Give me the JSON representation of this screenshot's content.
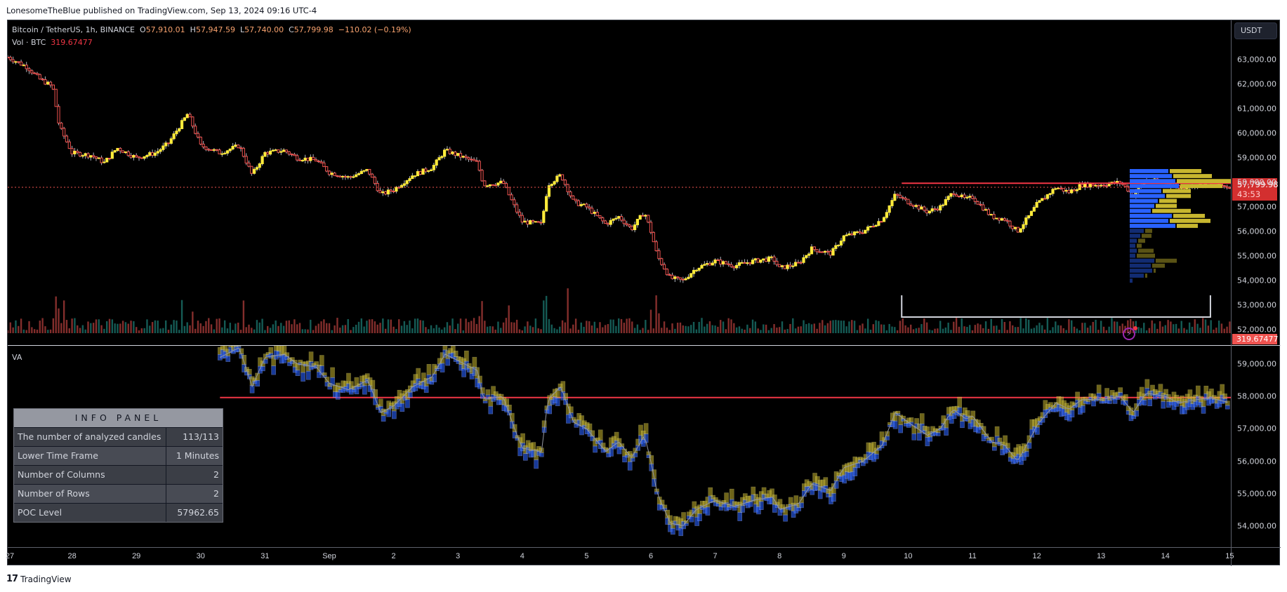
{
  "published": "LonesomeTheBlue published on TradingView.com, Sep 13, 2024 09:16 UTC-4",
  "legend": {
    "symbol": "Bitcoin / TetherUS, 1h, BINANCE",
    "o_label": "O",
    "o": "57,910.01",
    "h_label": "H",
    "h": "57,947.59",
    "l_label": "L",
    "l": "57,740.00",
    "c_label": "C",
    "c": "57,799.98",
    "change": "−110.02 (−0.19%)",
    "vol_label": "Vol · BTC",
    "vol": "319.67477"
  },
  "currency_button": "USDT",
  "last_price_tag": "57,799.98",
  "countdown": "43:53",
  "volume_tag": "319.67477",
  "lower_pane_label": "VA",
  "info_panel": {
    "title": "INFO PANEL",
    "rows": [
      {
        "label": "The number of analyzed candles",
        "value": "113/113"
      },
      {
        "label": "Lower Time Frame",
        "value": "1 Minutes"
      },
      {
        "label": "Number of Columns",
        "value": "2"
      },
      {
        "label": "Number of Rows",
        "value": "2"
      },
      {
        "label": "POC Level",
        "value": "57962.65"
      }
    ]
  },
  "footer": {
    "logo": "17",
    "brand": "TradingView"
  },
  "colors": {
    "up": "#ffeb3b",
    "down": "#ef5350",
    "vol_up": "#26a69a",
    "vol_down": "#ef5350",
    "poc_line": "#f23645",
    "profile_buy": "#2962ff",
    "profile_sell": "#c8b72f",
    "range_box": "#d1d4dc"
  },
  "chart_data": [
    {
      "type": "candlestick",
      "title": "Bitcoin / TetherUS, 1h, BINANCE",
      "yaxis_ticks": [
        "63,000.00",
        "62,000.00",
        "61,000.00",
        "60,000.00",
        "59,000.00",
        "58,000.00",
        "57,000.00",
        "56,000.00",
        "55,000.00",
        "54,000.00",
        "53,000.00",
        "52,000.00"
      ],
      "ylim": [
        51500,
        63300
      ],
      "xaxis_ticks": [
        "27",
        "28",
        "29",
        "30",
        "31",
        "Sep",
        "2",
        "3",
        "4",
        "5",
        "6",
        "7",
        "8",
        "9",
        "10",
        "11",
        "12",
        "13",
        "14",
        "15"
      ],
      "last_close": 57799.98,
      "poc_level": 57962.65,
      "price_path": [
        [
          27.0,
          63100
        ],
        [
          27.3,
          62700
        ],
        [
          27.5,
          62200
        ],
        [
          27.7,
          61900
        ],
        [
          27.8,
          60300
        ],
        [
          28.0,
          59200
        ],
        [
          28.3,
          59100
        ],
        [
          28.5,
          58800
        ],
        [
          28.7,
          59400
        ],
        [
          29.0,
          59000
        ],
        [
          29.3,
          59200
        ],
        [
          29.5,
          59600
        ],
        [
          29.8,
          60800
        ],
        [
          30.0,
          59500
        ],
        [
          30.3,
          59200
        ],
        [
          30.6,
          59500
        ],
        [
          30.8,
          58300
        ],
        [
          31.0,
          59200
        ],
        [
          31.3,
          59300
        ],
        [
          31.5,
          59000
        ],
        [
          31.8,
          58900
        ],
        [
          32.0,
          58400
        ],
        [
          32.3,
          58200
        ],
        [
          32.6,
          58500
        ],
        [
          32.8,
          57500
        ],
        [
          33.0,
          57700
        ],
        [
          33.3,
          58300
        ],
        [
          33.6,
          58600
        ],
        [
          33.8,
          59300
        ],
        [
          34.0,
          59100
        ],
        [
          34.3,
          58800
        ],
        [
          34.4,
          57900
        ],
        [
          34.7,
          58000
        ],
        [
          34.9,
          56900
        ],
        [
          35.0,
          56400
        ],
        [
          35.3,
          56300
        ],
        [
          35.4,
          57900
        ],
        [
          35.6,
          58300
        ],
        [
          35.8,
          57200
        ],
        [
          36.0,
          57000
        ],
        [
          36.3,
          56300
        ],
        [
          36.5,
          56600
        ],
        [
          36.7,
          56100
        ],
        [
          36.9,
          56800
        ],
        [
          37.0,
          56000
        ],
        [
          37.1,
          55000
        ],
        [
          37.3,
          54100
        ],
        [
          37.5,
          54000
        ],
        [
          37.7,
          54500
        ],
        [
          38.0,
          54800
        ],
        [
          38.3,
          54600
        ],
        [
          38.6,
          54800
        ],
        [
          38.9,
          54900
        ],
        [
          39.0,
          54500
        ],
        [
          39.3,
          54700
        ],
        [
          39.5,
          55300
        ],
        [
          39.8,
          55100
        ],
        [
          40.0,
          55800
        ],
        [
          40.3,
          56000
        ],
        [
          40.6,
          56500
        ],
        [
          40.8,
          57500
        ],
        [
          41.0,
          57200
        ],
        [
          41.3,
          56800
        ],
        [
          41.5,
          57000
        ],
        [
          41.7,
          57600
        ],
        [
          41.9,
          57300
        ],
        [
          42.0,
          57400
        ],
        [
          42.3,
          56600
        ],
        [
          42.5,
          56500
        ],
        [
          42.7,
          56000
        ],
        [
          42.9,
          56700
        ],
        [
          43.0,
          57100
        ],
        [
          43.3,
          57800
        ],
        [
          43.5,
          57600
        ],
        [
          43.7,
          57900
        ],
        [
          44.0,
          57900
        ],
        [
          44.3,
          58000
        ],
        [
          44.5,
          57500
        ],
        [
          44.7,
          58100
        ],
        [
          45.0,
          58000
        ],
        [
          45.2,
          57800
        ],
        [
          45.5,
          57900
        ],
        [
          45.7,
          57950
        ],
        [
          46.0,
          57800
        ]
      ],
      "volume_note": "BTC volume bars: green for up candles, red for down candles"
    },
    {
      "type": "bar",
      "title": "Volume profile (right side)",
      "series": [
        {
          "name": "buy",
          "color": "#2962ff",
          "values": [
            55,
            60,
            65,
            70,
            45,
            50,
            40,
            35,
            30,
            60,
            55,
            65,
            20,
            15,
            10,
            8,
            10,
            8,
            35,
            30,
            32,
            20,
            4
          ]
        },
        {
          "name": "sell",
          "color": "#c8b72f",
          "values": [
            45,
            55,
            90,
            60,
            40,
            35,
            25,
            30,
            55,
            45,
            58,
            30,
            10,
            14,
            10,
            7,
            22,
            26,
            30,
            18,
            3,
            3
          ]
        }
      ]
    },
    {
      "type": "candlestick",
      "title": "VA",
      "yaxis_ticks": [
        "59,000.00",
        "58,000.00",
        "57,000.00",
        "56,000.00",
        "55,000.00",
        "54,000.00"
      ],
      "ylim": [
        53900,
        59100
      ],
      "poc_level": 57962.65
    }
  ]
}
